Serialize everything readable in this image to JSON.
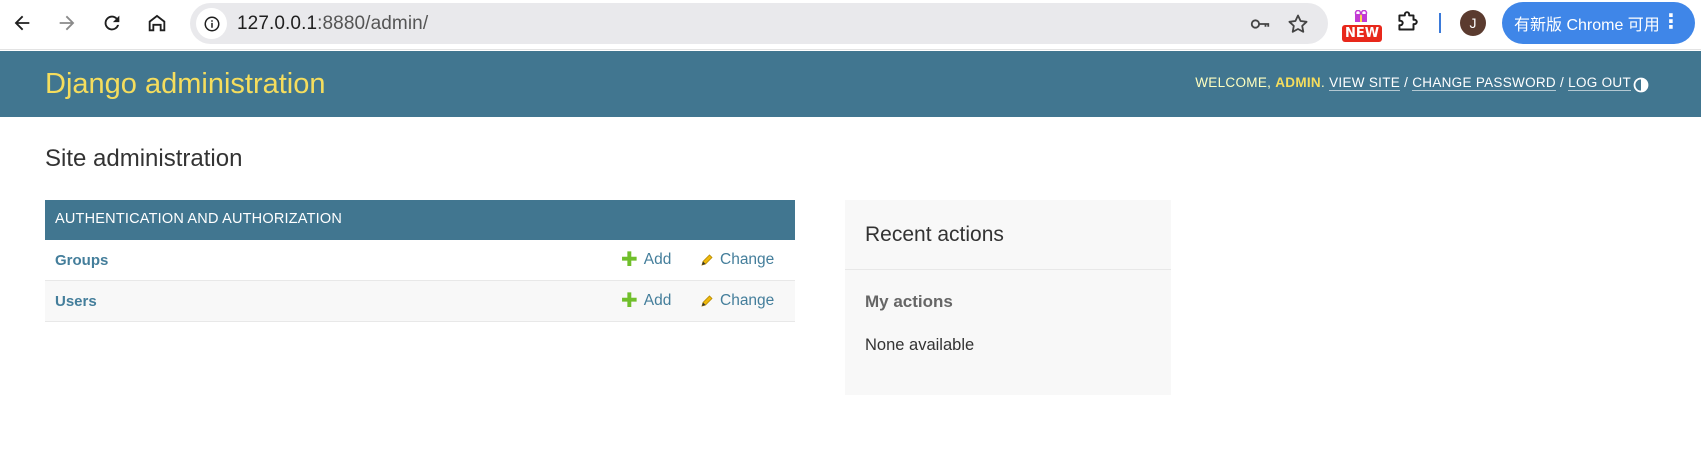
{
  "browser": {
    "url_host": "127.0.0.1",
    "url_rest": ":8880/admin/",
    "ext_badge": "NEW",
    "profile_initial": "J",
    "update_label": "有新版 Chrome 可用",
    "update_menu": "⋮"
  },
  "header": {
    "brand": "Django administration",
    "welcome": "WELCOME, ",
    "username": "ADMIN",
    "period": ". ",
    "view_site": "VIEW SITE",
    "sep1": " / ",
    "change_password": "CHANGE PASSWORD",
    "sep2": " / ",
    "log_out": "LOG OUT"
  },
  "content": {
    "page_title": "Site administration",
    "app": {
      "caption": "AUTHENTICATION AND AUTHORIZATION",
      "models": [
        {
          "name": "Groups",
          "add": "Add",
          "change": "Change"
        },
        {
          "name": "Users",
          "add": "Add",
          "change": "Change"
        }
      ]
    },
    "recent": {
      "title": "Recent actions",
      "subtitle": "My actions",
      "empty": "None available"
    }
  },
  "colors": {
    "header_bg": "#417690",
    "brand": "#f5dd5d",
    "link": "#447e9b",
    "add_green": "#70bf2b",
    "chrome_update": "#3f86e8"
  },
  "icons": {
    "back": "arrow-left-icon",
    "forward": "arrow-right-icon",
    "reload": "reload-icon",
    "home": "home-icon",
    "site_info": "info-icon",
    "password": "key-icon",
    "bookmark": "star-icon",
    "extensions": "puzzle-icon",
    "theme": "half-circle-icon",
    "add": "plus-icon",
    "change": "pencil-icon"
  }
}
